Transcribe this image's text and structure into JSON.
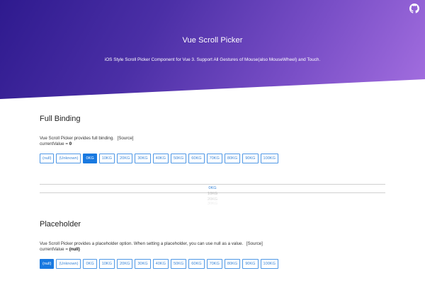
{
  "hero": {
    "title": "Vue Scroll Picker",
    "subtitle": "iOS Style Scroll Picker Component for Vue 3. Support All Gestures of Mouse(also MouseWheel) and Touch.",
    "github_icon": "github-icon"
  },
  "full_binding": {
    "title": "Full Binding",
    "desc_text": "Vue Scroll Picker provides full binding.",
    "source_link": "[Source]",
    "current_label": "currentValue = ",
    "current_value": "0",
    "buttons": [
      "(null)",
      "(Unknown)",
      "0KG",
      "10KG",
      "20KG",
      "30KG",
      "40KG",
      "50KG",
      "60KG",
      "70KG",
      "80KG",
      "90KG",
      "100KG"
    ],
    "active_button": "0KG"
  },
  "picker": {
    "options": [
      "0KG",
      "10KG",
      "20KG",
      "30KG"
    ],
    "selected": "0KG"
  },
  "placeholder": {
    "title": "Placeholder",
    "desc_text": "Vue Scroll Picker provides a placeholder option. When setting a placeholder, you can use null as a value.",
    "source_link": "[Source]",
    "current_label": "currentValue = ",
    "current_value": "(null)",
    "buttons": [
      "(null)",
      "(Unknown)",
      "0KG",
      "10KG",
      "20KG",
      "30KG",
      "40KG",
      "50KG",
      "60KG",
      "70KG",
      "80KG",
      "90KG",
      "100KG"
    ],
    "active_button": "(null)"
  },
  "colors": {
    "hero_start": "#2e1a8e",
    "hero_end": "#a46fe0",
    "button_border": "#4d97e6",
    "button_active": "#1979e0"
  }
}
